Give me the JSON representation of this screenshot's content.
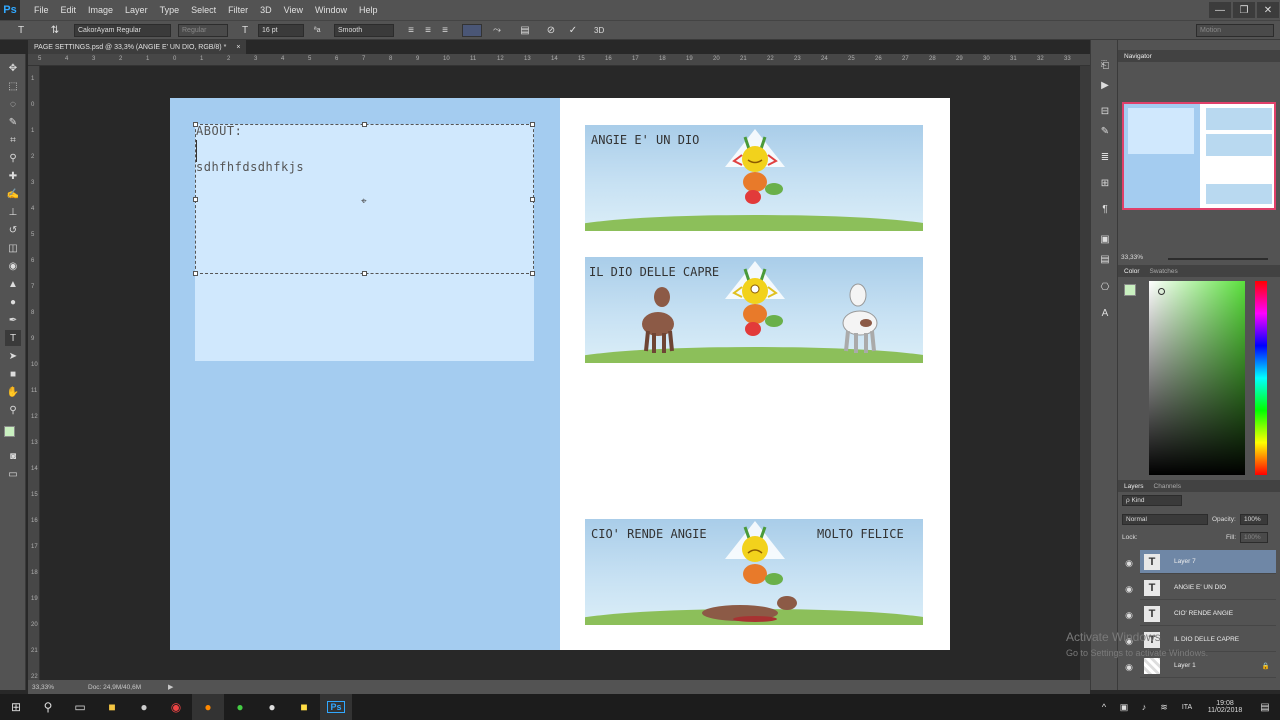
{
  "app": {
    "logo": "Ps"
  },
  "menu": [
    "File",
    "Edit",
    "Image",
    "Layer",
    "Type",
    "Select",
    "Filter",
    "3D",
    "View",
    "Window",
    "Help"
  ],
  "window_controls": {
    "minimize": "—",
    "restore": "❐",
    "close": "✕"
  },
  "options": {
    "font_family": "CakorAyam Regular",
    "font_style": "Regular",
    "font_size": "16 pt",
    "aa_label": "ªa",
    "antialias": "Smooth",
    "mode_3d": "3D",
    "workspace": "Motion"
  },
  "document_tab": {
    "title": "PAGE SETTINGS.psd @ 33,3% (ANGIE E' UN DIO, RGB/8) *",
    "close": "×"
  },
  "ruler_h": [
    "5",
    "4",
    "3",
    "2",
    "1",
    "0",
    "1",
    "2",
    "3",
    "4",
    "5",
    "6",
    "7",
    "8",
    "9",
    "10",
    "11",
    "12",
    "13",
    "14",
    "15",
    "16",
    "17",
    "18",
    "19",
    "20",
    "21",
    "22",
    "23",
    "24",
    "25",
    "26",
    "27",
    "28",
    "29",
    "30",
    "31",
    "32",
    "33",
    "34"
  ],
  "ruler_v": [
    "1",
    "0",
    "1",
    "2",
    "3",
    "4",
    "5",
    "6",
    "7",
    "8",
    "9",
    "10",
    "11",
    "12",
    "13",
    "14",
    "15",
    "16",
    "17",
    "18",
    "19",
    "20",
    "21",
    "22"
  ],
  "canvas": {
    "about_heading": "ABOUT:",
    "about_body": "sdhfhfdsdhfkjs",
    "banners": [
      {
        "title": "ANGIE E' UN DIO",
        "title_right": ""
      },
      {
        "title": "IL DIO DELLE CAPRE",
        "title_right": ""
      },
      {
        "title": "CIO' RENDE ANGIE",
        "title_right": "MOLTO FELICE"
      }
    ]
  },
  "status": {
    "zoom": "33,33%",
    "doc": "Doc: 24,9M/40,6M",
    "arrow": "▶"
  },
  "navigator": {
    "title": "Navigator",
    "zoom": "33,33%"
  },
  "color_panel": {
    "tabs": [
      "Color",
      "Swatches"
    ],
    "fg": "#c9f0c0",
    "spectrum_hue": "#5ae03c"
  },
  "layers_panel": {
    "tabs": [
      "Layers",
      "Channels"
    ],
    "filter_label": "ρ Kind",
    "blend_mode": "Normal",
    "opacity_label": "Opacity:",
    "opacity": "100%",
    "lock_label": "Lock:",
    "fill_label": "Fill:",
    "fill": "100%",
    "layers": [
      {
        "name": "Layer 7",
        "type": "T",
        "selected": true
      },
      {
        "name": "ANGIE E' UN DIO",
        "type": "T",
        "selected": false
      },
      {
        "name": "CIO' RENDE ANGIE",
        "type": "T",
        "selected": false
      },
      {
        "name": "IL DIO DELLE CAPRE",
        "type": "T",
        "selected": false
      },
      {
        "name": "Layer 1",
        "type": "img",
        "selected": false
      }
    ]
  },
  "watermark": {
    "line1": "Activate Windows",
    "line2": "Go to Settings to activate Windows."
  },
  "taskbar": {
    "time": "19:08",
    "date": "11/02/2018",
    "lang": "ITA"
  }
}
